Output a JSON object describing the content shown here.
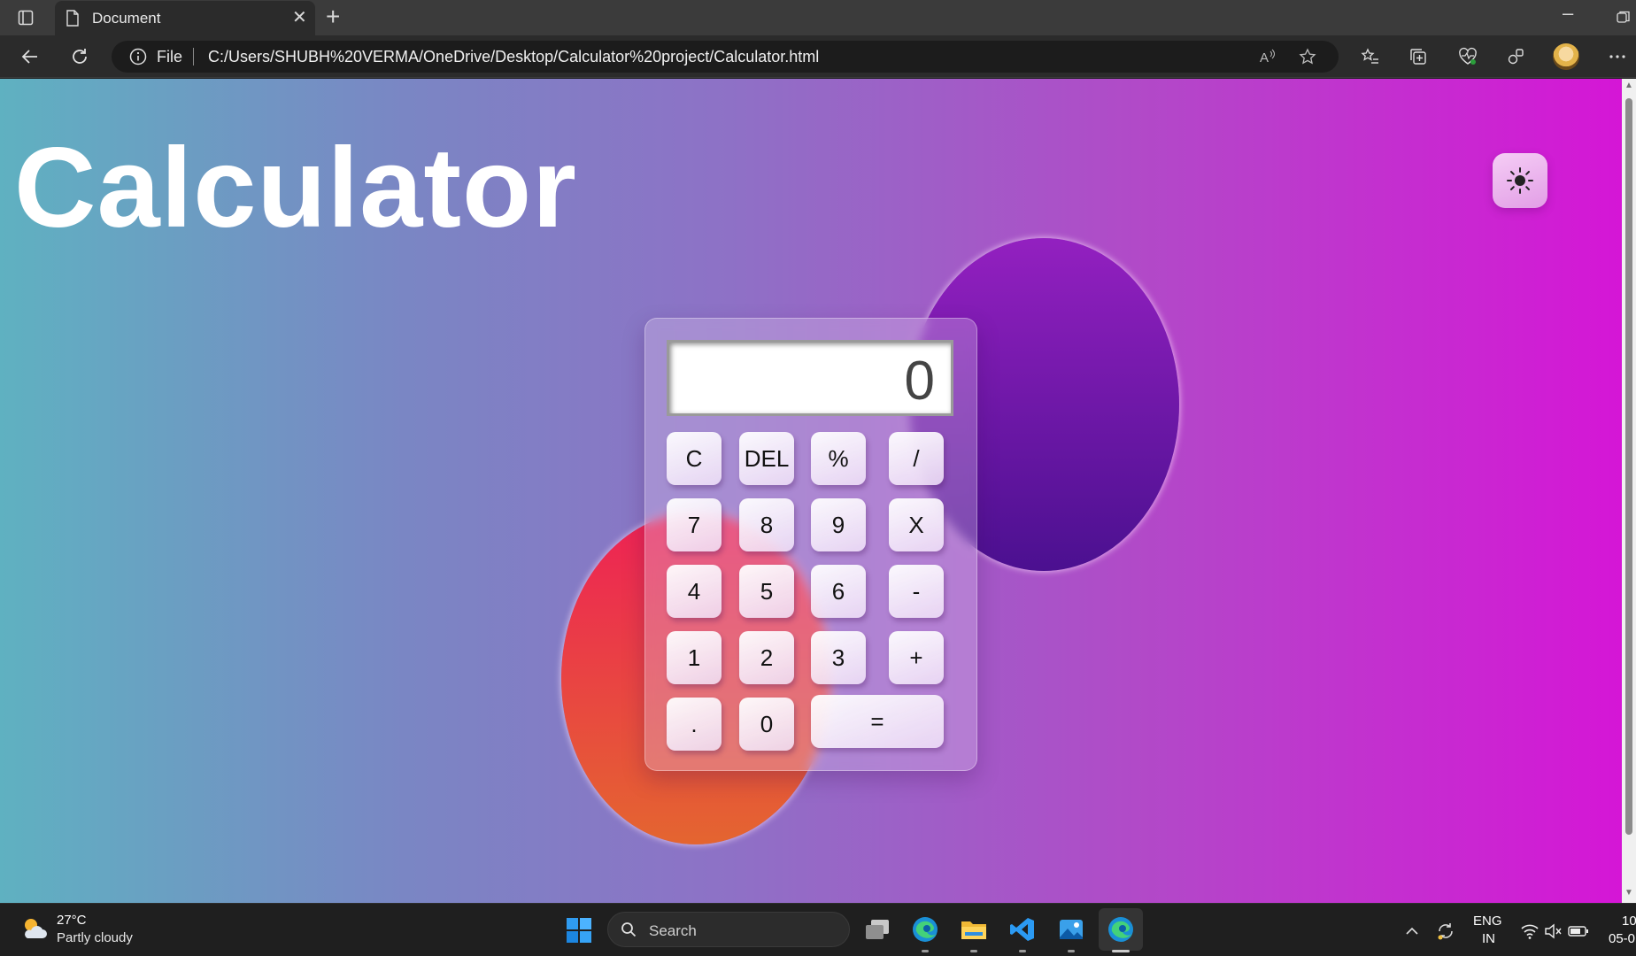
{
  "browser": {
    "tab_title": "Document",
    "file_label": "File",
    "url": "C:/Users/SHUBH%20VERMA/OneDrive/Desktop/Calculator%20project/Calculator.html"
  },
  "page": {
    "title": "Calculator",
    "theme_toggle_icon": "sun-icon",
    "colors": {
      "bg_start": "#5fb1c1",
      "bg_end": "#d516d6",
      "circle_purple": "#9320c0",
      "circle_orange": "#ee2255"
    }
  },
  "calculator": {
    "display": "0",
    "keys": {
      "clear": "C",
      "del": "DEL",
      "percent": "%",
      "divide": "/",
      "seven": "7",
      "eight": "8",
      "nine": "9",
      "multiply": "X",
      "four": "4",
      "five": "5",
      "six": "6",
      "minus": "-",
      "one": "1",
      "two": "2",
      "three": "3",
      "plus": "+",
      "dot": ".",
      "zero": "0",
      "equals": "="
    }
  },
  "taskbar": {
    "temperature": "27°C",
    "weather": "Partly cloudy",
    "search_placeholder": "Search",
    "lang_line1": "ENG",
    "lang_line2": "IN",
    "clock_line1": "10",
    "clock_line2": "05-0"
  }
}
